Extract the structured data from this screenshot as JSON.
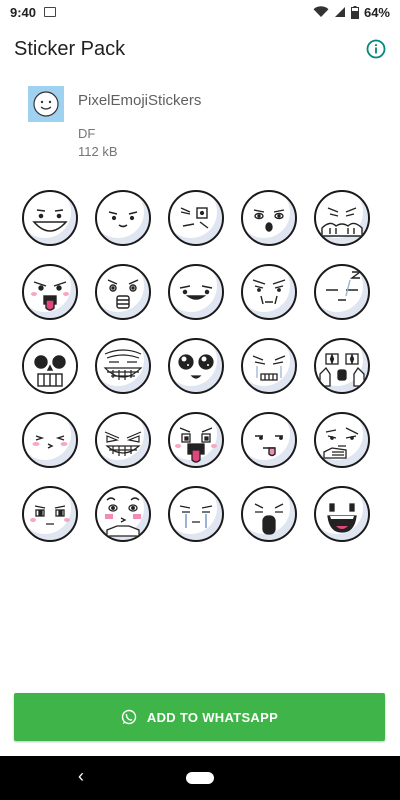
{
  "status_bar": {
    "time": "9:40",
    "battery": "64%"
  },
  "app_bar": {
    "title": "Sticker Pack"
  },
  "pack": {
    "name": "PixelEmojiStickers",
    "author": "DF",
    "size": "112 kB"
  },
  "stickers": [
    "grin",
    "smirk",
    "worried",
    "blank-stare",
    "facepalm",
    "tongue-out",
    "surprised",
    "smug",
    "dismayed",
    "sleepy",
    "skull",
    "trollface",
    "sparkle-eyes",
    "crying",
    "shocked-hands",
    "blush-kiss",
    "evil-grin",
    "tongue-wide-eyes",
    "tongue-bored",
    "thinking",
    "plain-blush",
    "blush-hands",
    "teary",
    "wail",
    "laughing"
  ],
  "cta": {
    "label": "ADD TO WHATSAPP"
  },
  "colors": {
    "accent_green": "#3fb549",
    "info_teal": "#00897b",
    "tray_bg": "#9fd1f0"
  }
}
